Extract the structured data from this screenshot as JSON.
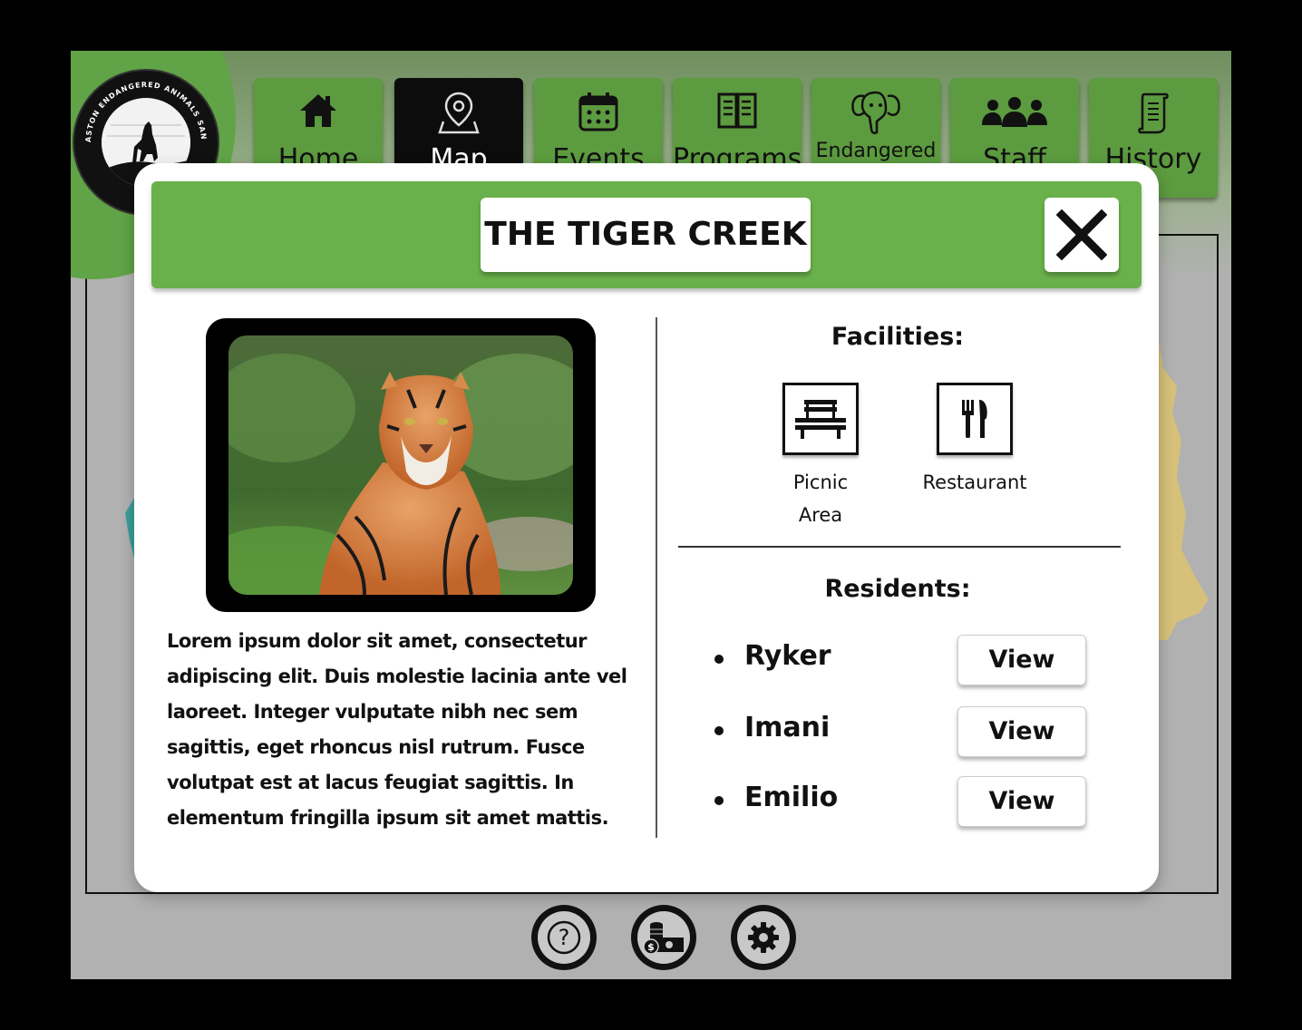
{
  "app": {
    "logo_text": "ASTON ENDANGERED ANIMALS SANCTUARY"
  },
  "nav": {
    "items": [
      {
        "label": "Home",
        "icon": "home-icon",
        "active": false
      },
      {
        "label": "Map",
        "icon": "map-pin-icon",
        "active": true
      },
      {
        "label": "Events",
        "icon": "calendar-icon",
        "active": false
      },
      {
        "label": "Programs",
        "icon": "book-icon",
        "active": false
      },
      {
        "label": "Endangered",
        "icon": "elephant-icon",
        "active": false
      },
      {
        "label": "Staff",
        "icon": "people-icon",
        "active": false
      },
      {
        "label": "History",
        "icon": "scroll-icon",
        "active": false
      }
    ]
  },
  "modal": {
    "title": "THE TIGER CREEK",
    "close_icon": "close-icon",
    "image_subject": "tiger",
    "description": "Lorem ipsum dolor sit amet, consectetur adipiscing elit. Duis molestie lacinia ante vel laoreet. Integer vulputate nibh nec sem sagittis, eget rhoncus nisl rutrum. Fusce volutpat est at lacus feugiat sagittis. In elementum fringilla ipsum sit amet mattis.",
    "facilities_title": "Facilities:",
    "facilities": [
      {
        "label": "Picnic Area",
        "icon": "bench-icon"
      },
      {
        "label": "Restaurant",
        "icon": "utensils-icon"
      }
    ],
    "residents_title": "Residents:",
    "residents": [
      {
        "name": "Ryker",
        "button": "View"
      },
      {
        "name": "Imani",
        "button": "View"
      },
      {
        "name": "Emilio",
        "button": "View"
      }
    ]
  },
  "footer": {
    "buttons": [
      {
        "icon": "help-icon"
      },
      {
        "icon": "donate-icon"
      },
      {
        "icon": "settings-icon"
      }
    ]
  },
  "colors": {
    "accent_green": "#6ab04b",
    "nav_green": "#5c9b3f",
    "active_nav": "#0c0c0c",
    "background": "#b1b1b1"
  }
}
